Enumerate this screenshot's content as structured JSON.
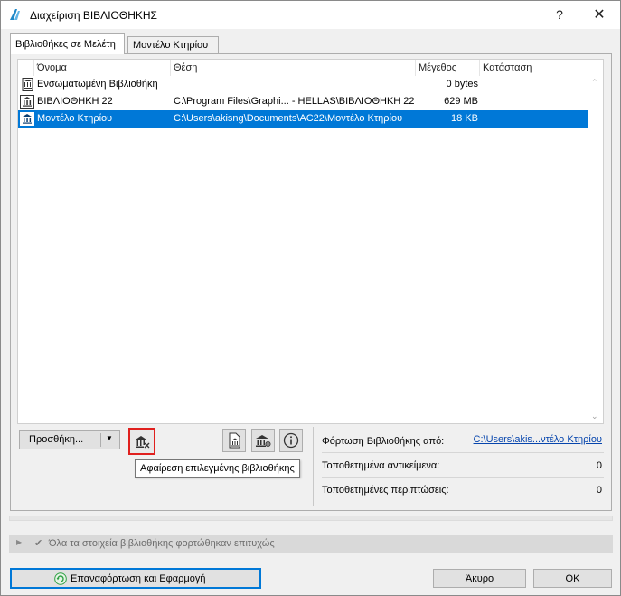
{
  "window": {
    "title": "Διαχείριση ΒΙΒΛΙΟΘΗΚΗΣ",
    "help_glyph": "?",
    "close_glyph": "✕"
  },
  "tabs": [
    {
      "label": "Βιβλιοθήκες σε Μελέτη",
      "active": true
    },
    {
      "label": "Μοντέλο Κτηρίου",
      "active": false
    }
  ],
  "table": {
    "columns": [
      "Όνομα",
      "Θέση",
      "Μέγεθος",
      "Κατάσταση"
    ],
    "rows": [
      {
        "name": "Ενσωματωμένη Βιβλιοθήκη",
        "location": "",
        "size": "0 bytes",
        "status": "",
        "selected": false,
        "icon": "embedded-library-icon"
      },
      {
        "name": "ΒΙΒΛΙΟΘΗΚΗ 22",
        "location": "C:\\Program Files\\Graphi... - HELLAS\\ΒΙΒΛΙΟΘΗΚΗ 22",
        "size": "629 MB",
        "status": "",
        "selected": false,
        "icon": "library-icon"
      },
      {
        "name": "Μοντέλο Κτηρίου",
        "location": "C:\\Users\\akisng\\Documents\\AC22\\Μοντέλο Κτηρίου",
        "size": "18 KB",
        "status": "",
        "selected": true,
        "icon": "library-icon"
      }
    ]
  },
  "toolbar": {
    "add_label": "Προσθήκη...",
    "remove_tooltip": "Αφαίρεση επιλεγμένης βιβλιοθήκης"
  },
  "info": {
    "load_from_label": "Φόρτωση Βιβλιοθήκης από:",
    "load_from_value": "C:\\Users\\akis...ντέλο Κτηρίου",
    "placed_objects_label": "Τοποθετημένα αντικείμενα:",
    "placed_objects_value": "0",
    "placed_instances_label": "Τοποθετημένες περιπτώσεις:",
    "placed_instances_value": "0"
  },
  "status": {
    "message": "Όλα τα στοιχεία βιβλιοθήκης φορτώθηκαν επιτυχώς"
  },
  "footer": {
    "reload_label": "Επαναφόρτωση και Εφαρμογή",
    "cancel_label": "Άκυρο",
    "ok_label": "ΟΚ"
  },
  "colors": {
    "selection": "#0078d7",
    "highlight_border": "#e0201e",
    "link": "#0645ad",
    "reload_icon": "#2ea043"
  }
}
